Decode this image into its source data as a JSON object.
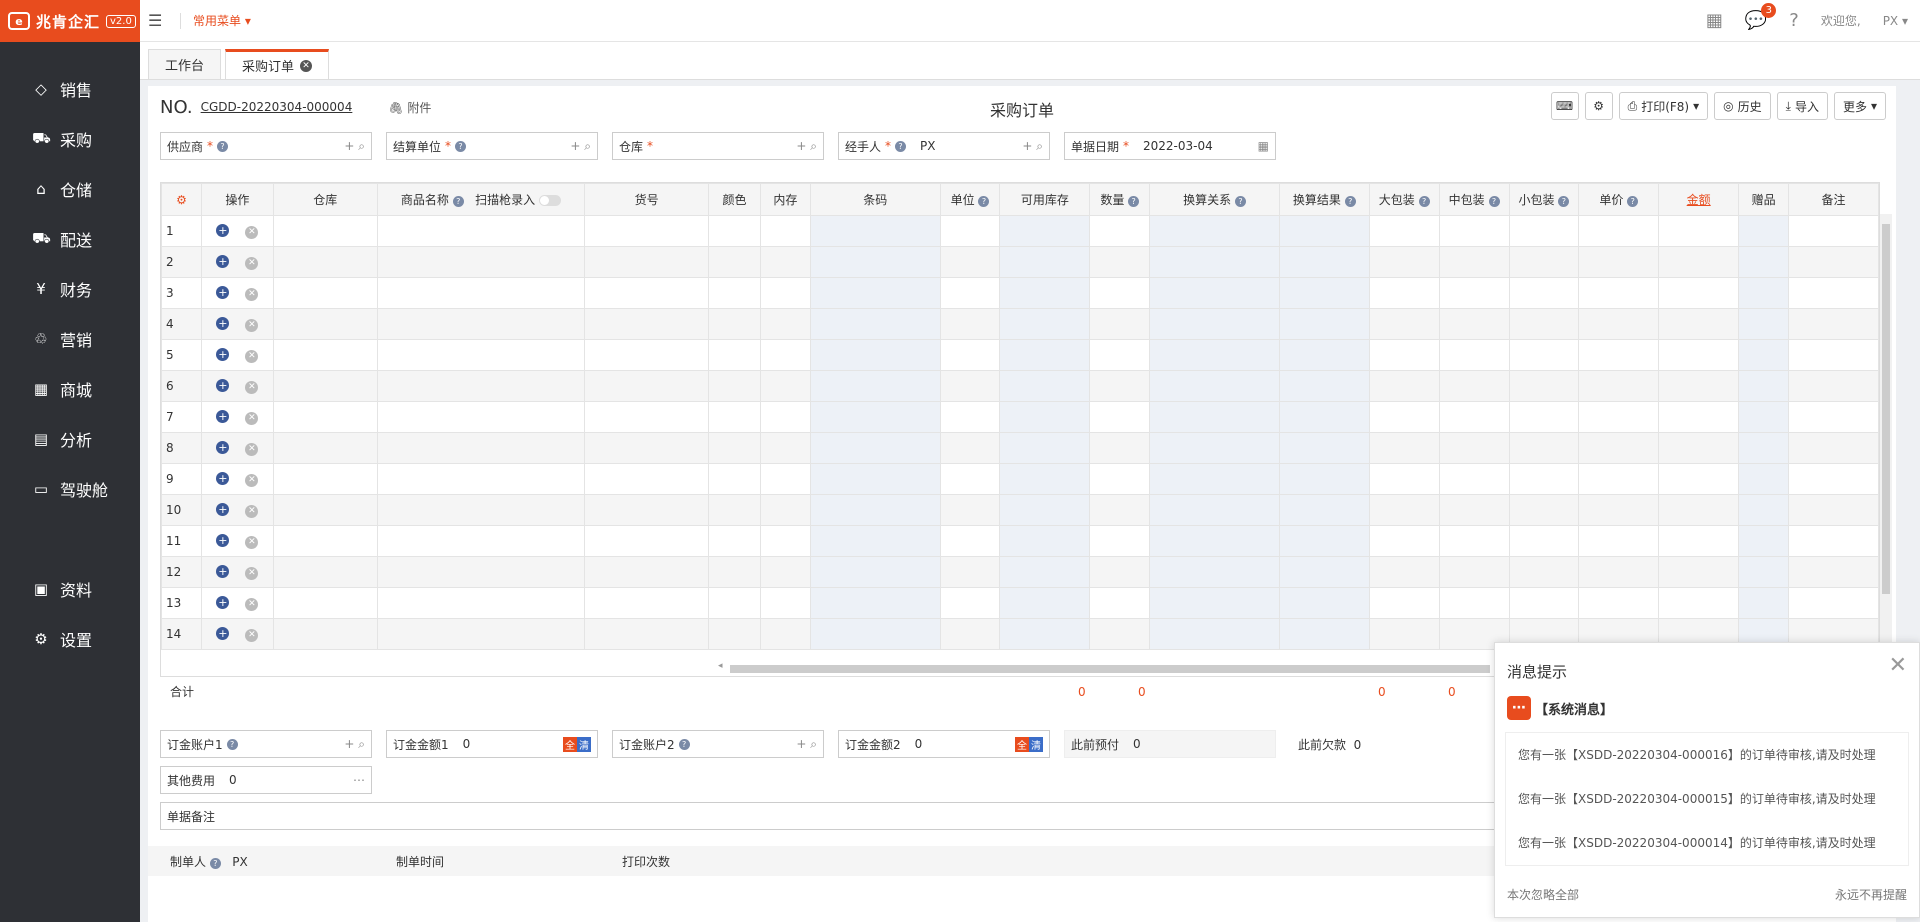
{
  "sidebar": {
    "logo_text": "兆肯企汇",
    "version": "v2.0",
    "items": [
      {
        "label": "销售",
        "icon": "tag-icon"
      },
      {
        "label": "采购",
        "icon": "cart-icon"
      },
      {
        "label": "仓储",
        "icon": "warehouse-icon"
      },
      {
        "label": "配送",
        "icon": "truck-icon"
      },
      {
        "label": "财务",
        "icon": "yen-icon"
      },
      {
        "label": "营销",
        "icon": "megaphone-icon"
      },
      {
        "label": "商城",
        "icon": "store-icon"
      },
      {
        "label": "分析",
        "icon": "chart-icon"
      },
      {
        "label": "驾驶舱",
        "icon": "monitor-icon"
      }
    ],
    "items2": [
      {
        "label": "资料",
        "icon": "file-icon"
      },
      {
        "label": "设置",
        "icon": "gear-icon"
      }
    ]
  },
  "topbar": {
    "common_menu": "常用菜单",
    "message_count": "3",
    "welcome": "欢迎您,",
    "user": "PX"
  },
  "tabs": [
    {
      "label": "工作台"
    },
    {
      "label": "采购订单"
    }
  ],
  "order": {
    "no_label": "NO.",
    "no_value": "CGDD-20220304-000004",
    "attach": "附件",
    "title": "采购订单",
    "print": "打印(F8)",
    "history": "历史",
    "import": "导入",
    "more": "更多"
  },
  "fields": {
    "supplier": "供应商",
    "settle": "结算单位",
    "warehouse": "仓库",
    "handler": "经手人",
    "handler_val": "PX",
    "date": "单据日期",
    "date_val": "2022-03-04"
  },
  "grid": {
    "headers": [
      "操作",
      "仓库",
      "商品名称",
      "扫描枪录入",
      "货号",
      "颜色",
      "内存",
      "条码",
      "单位",
      "可用库存",
      "数量",
      "换算关系",
      "换算结果",
      "大包装",
      "中包装",
      "小包装",
      "单价",
      "金额",
      "赠品",
      "备注"
    ],
    "rows": [
      "1",
      "2",
      "3",
      "4",
      "5",
      "6",
      "7",
      "8",
      "9",
      "10",
      "11",
      "12",
      "13",
      "14"
    ],
    "total_label": "合计",
    "totals": [
      "0",
      "0",
      "0",
      "0"
    ]
  },
  "bottom": {
    "acc1": "订金账户1",
    "amt1": "订金金额1",
    "amt1_val": "0",
    "acc2": "订金账户2",
    "amt2": "订金金额2",
    "amt2_val": "0",
    "prepaid": "此前预付",
    "prepaid_val": "0",
    "debt": "此前欠款",
    "debt_val": "0",
    "other_fee": "其他费用",
    "other_fee_val": "0",
    "remark": "单据备注",
    "all_tag": "全",
    "clear_tag": "清",
    "maker": "制单人",
    "maker_val": "PX",
    "make_time": "制单时间",
    "print_count": "打印次数"
  },
  "popup": {
    "title": "消息提示",
    "sys": "【系统消息】",
    "messages": [
      "您有一张【XSDD-20220304-000016】的订单待审核,请及时处理",
      "您有一张【XSDD-20220304-000015】的订单待审核,请及时处理",
      "您有一张【XSDD-20220304-000014】的订单待审核,请及时处理"
    ],
    "ignore": "本次忽略全部",
    "never": "永远不再提醒"
  }
}
